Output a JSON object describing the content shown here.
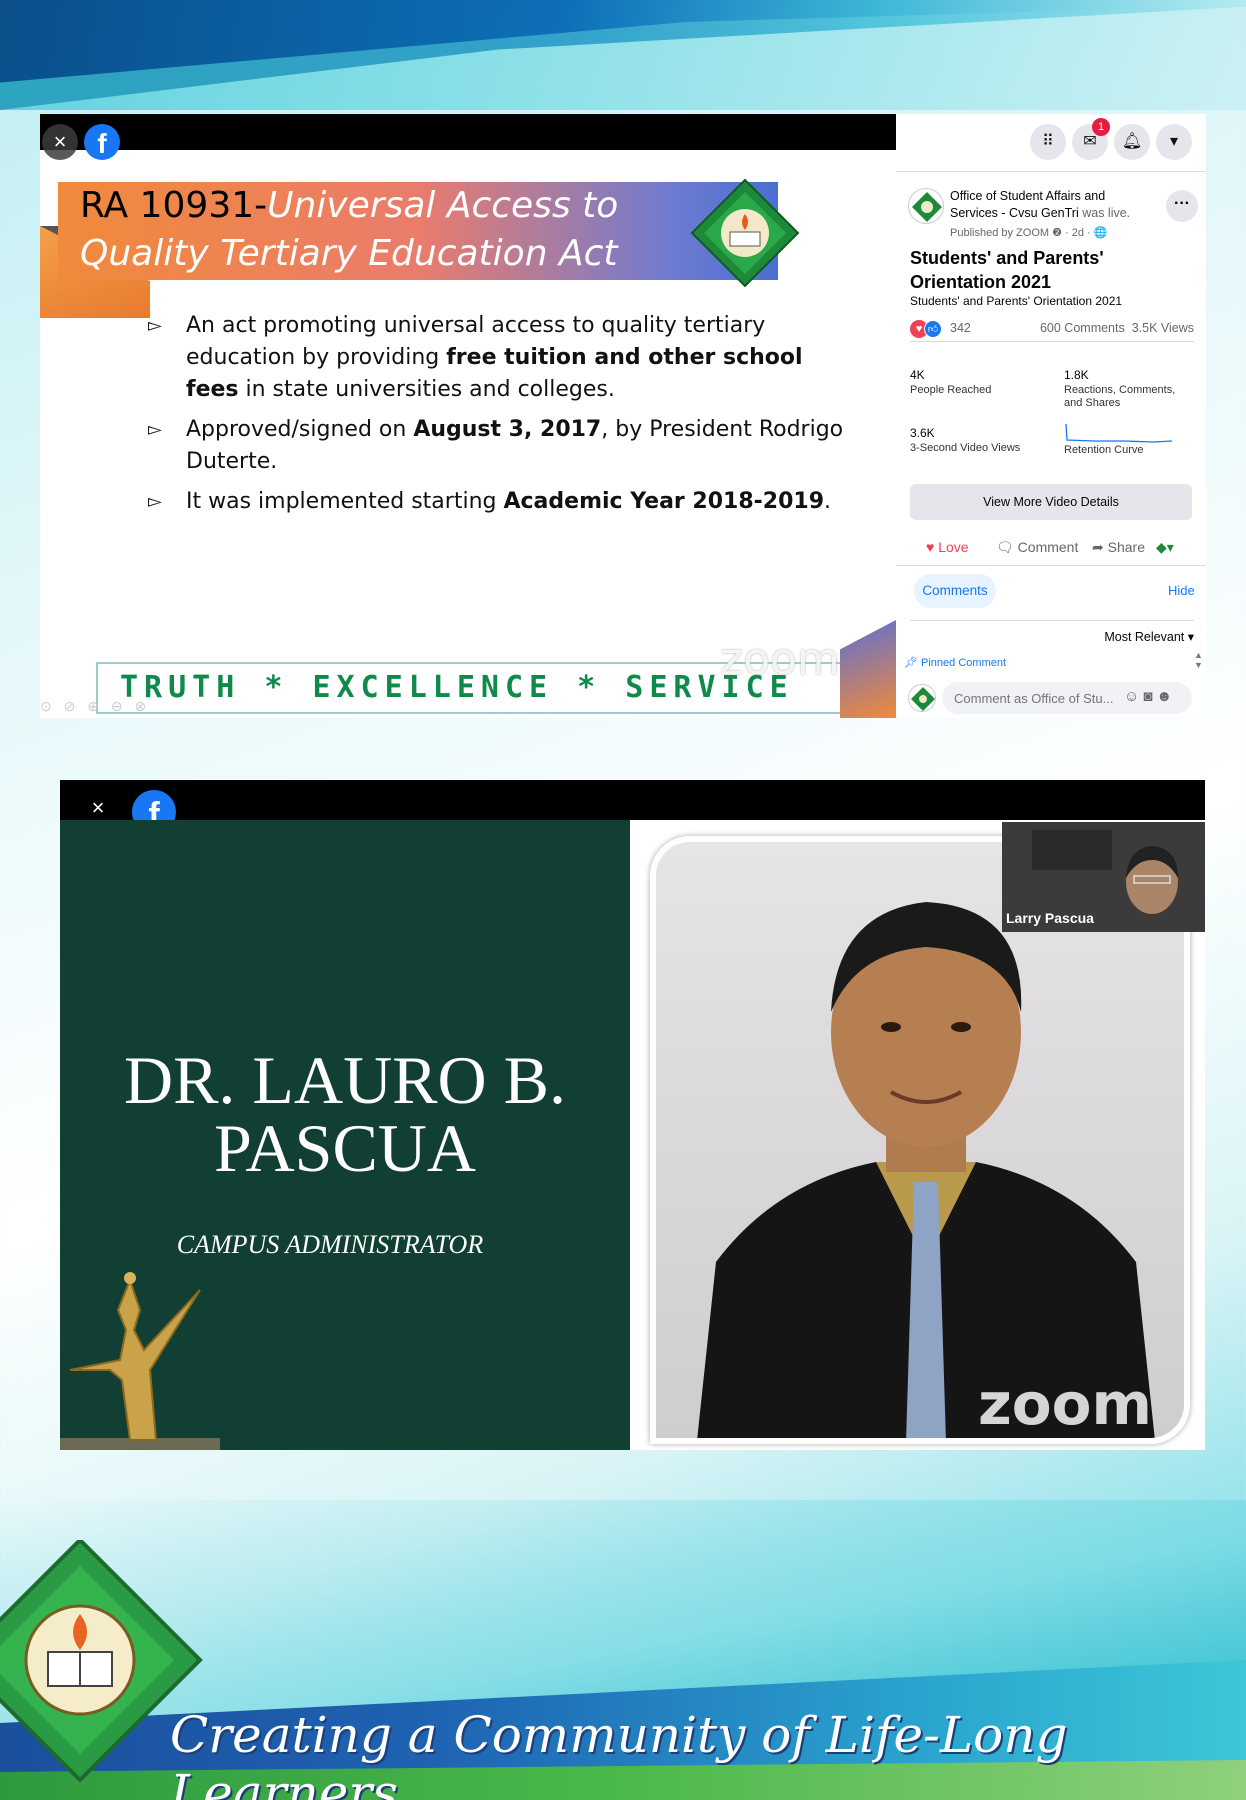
{
  "facebook_viewer": {
    "close_glyph": "×",
    "fb_glyph": "f",
    "slide": {
      "title_prefix": "RA 10931-",
      "title_rest": "Universal Access to Quality Tertiary Education Act",
      "bullets": [
        {
          "pre": "An act promoting universal access to quality tertiary education by providing ",
          "bold": "free tuition and other school fees",
          "post": " in state universities and colleges."
        },
        {
          "pre": "Approved/signed on ",
          "bold": "August 3, 2017",
          "post": ", by President Rodrigo Duterte."
        },
        {
          "pre": "It was implemented starting ",
          "bold": "Academic Year 2018-2019",
          "post": "."
        }
      ],
      "bullet_glyph": "▻",
      "motto": "TRUTH * EXCELLENCE * SERVICE",
      "zoom_watermark": "zoom"
    },
    "panel": {
      "notification_count": "1",
      "page_name": "Office of Student Affairs and Services - Cvsu GenTri",
      "live_text": "was live.",
      "published": "Published by ZOOM ❷ · 2d · 🌐",
      "video_title": "Students' and Parents' Orientation 2021",
      "video_subtitle": "Students' and Parents' Orientation 2021",
      "reaction_count": "342",
      "comments_count": "600 Comments",
      "views_count": "3.5K Views",
      "stats": {
        "people_reached": "4K",
        "people_reached_label": "People Reached",
        "engagements": "1.8K",
        "engagements_label": "Reactions, Comments, and Shares",
        "three_sec_views": "3.6K",
        "three_sec_label": "3-Second Video Views",
        "retention_label": "Retention Curve"
      },
      "view_more_label": "View More Video Details",
      "actions": {
        "love": "Love",
        "comment": "Comment",
        "share": "Share"
      },
      "comments_tab": "Comments",
      "hide_label": "Hide",
      "sort_label": "Most Relevant ▾",
      "pinned_label": "Pinned Comment",
      "comment_placeholder": "Comment as Office of Stu..."
    }
  },
  "speaker_frame": {
    "name": "DR. LAURO B. PASCUA",
    "role": "CAMPUS ADMINISTRATOR",
    "participant_name": "Larry Pascua",
    "zoom_logo": "zoom"
  },
  "footer": {
    "tagline": "Creating a Community of Life-Long Learners"
  },
  "colors": {
    "facebook_blue": "#1877f2",
    "slide_green": "#123f33",
    "motto_green": "#0f8a4a"
  }
}
